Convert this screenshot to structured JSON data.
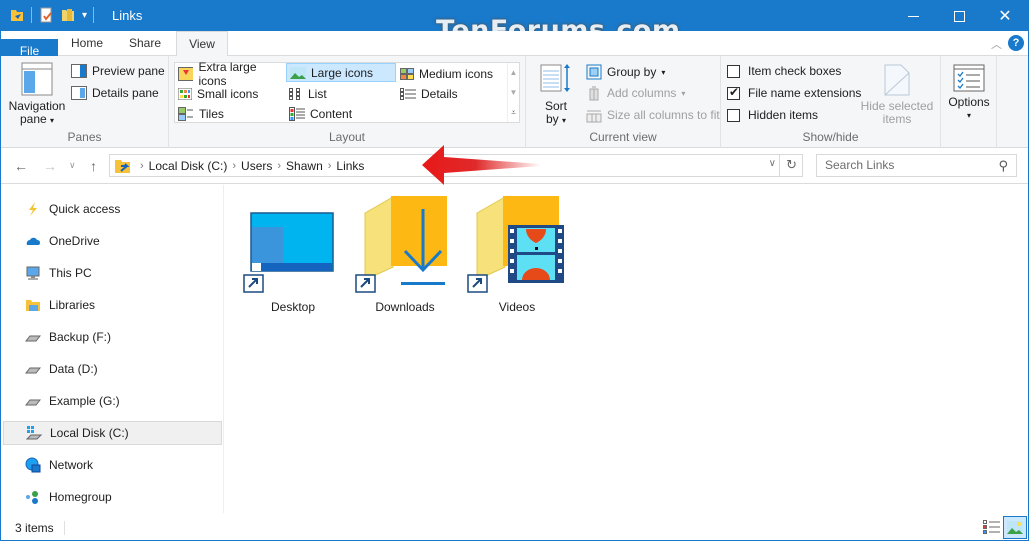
{
  "window": {
    "title": "Links",
    "watermark": "TenForums.com",
    "controls": {
      "minimize": "—",
      "maximize": "☐",
      "close": "✕"
    }
  },
  "tabs": [
    {
      "label": "File"
    },
    {
      "label": "Home"
    },
    {
      "label": "Share"
    },
    {
      "label": "View",
      "active": true
    }
  ],
  "ribbon": {
    "panes": {
      "label": "Panes",
      "navigation_pane": "Navigation pane",
      "navigation_pane_line1": "Navigation",
      "navigation_pane_line2": "pane",
      "preview_pane": "Preview pane",
      "details_pane": "Details pane"
    },
    "layout": {
      "label": "Layout",
      "items": [
        {
          "label": "Extra large icons"
        },
        {
          "label": "Large icons",
          "selected": true
        },
        {
          "label": "Medium icons"
        },
        {
          "label": "Small icons"
        },
        {
          "label": "List"
        },
        {
          "label": "Details"
        },
        {
          "label": "Tiles"
        },
        {
          "label": "Content"
        }
      ]
    },
    "current_view": {
      "label": "Current view",
      "sort_by_line1": "Sort",
      "sort_by_line2": "by",
      "group_by": "Group by",
      "add_columns": "Add columns",
      "size_columns": "Size all columns to fit"
    },
    "show_hide": {
      "label": "Show/hide",
      "item_check_boxes": {
        "label": "Item check boxes",
        "checked": false
      },
      "file_name_extensions": {
        "label": "File name extensions",
        "checked": true
      },
      "hidden_items": {
        "label": "Hidden items",
        "checked": false
      },
      "hide_selected_line1": "Hide selected",
      "hide_selected_line2": "items"
    },
    "options": {
      "label": "Options"
    }
  },
  "address": {
    "crumbs": [
      "Local Disk (C:)",
      "Users",
      "Shawn",
      "Links"
    ],
    "search_placeholder": "Search Links"
  },
  "sidebar": {
    "items": [
      {
        "label": "Quick access",
        "icon": "quick-access-icon"
      },
      {
        "label": "OneDrive",
        "icon": "onedrive-icon"
      },
      {
        "label": "This PC",
        "icon": "this-pc-icon"
      },
      {
        "label": "Libraries",
        "icon": "libraries-icon"
      },
      {
        "label": "Backup (F:)",
        "icon": "drive-icon"
      },
      {
        "label": "Data (D:)",
        "icon": "drive-icon"
      },
      {
        "label": "Example (G:)",
        "icon": "drive-icon"
      },
      {
        "label": "Local Disk (C:)",
        "icon": "system-drive-icon",
        "selected": true
      },
      {
        "label": "Network",
        "icon": "network-icon"
      },
      {
        "label": "Homegroup",
        "icon": "homegroup-icon"
      }
    ]
  },
  "files": [
    {
      "name": "Desktop",
      "icon": "desktop-shortcut-icon"
    },
    {
      "name": "Downloads",
      "icon": "downloads-shortcut-icon"
    },
    {
      "name": "Videos",
      "icon": "videos-shortcut-icon"
    }
  ],
  "status": {
    "item_count": "3 items"
  },
  "colors": {
    "accent": "#1979ca",
    "selection": "#cce8ff",
    "annotation_arrow": "#e81818"
  }
}
